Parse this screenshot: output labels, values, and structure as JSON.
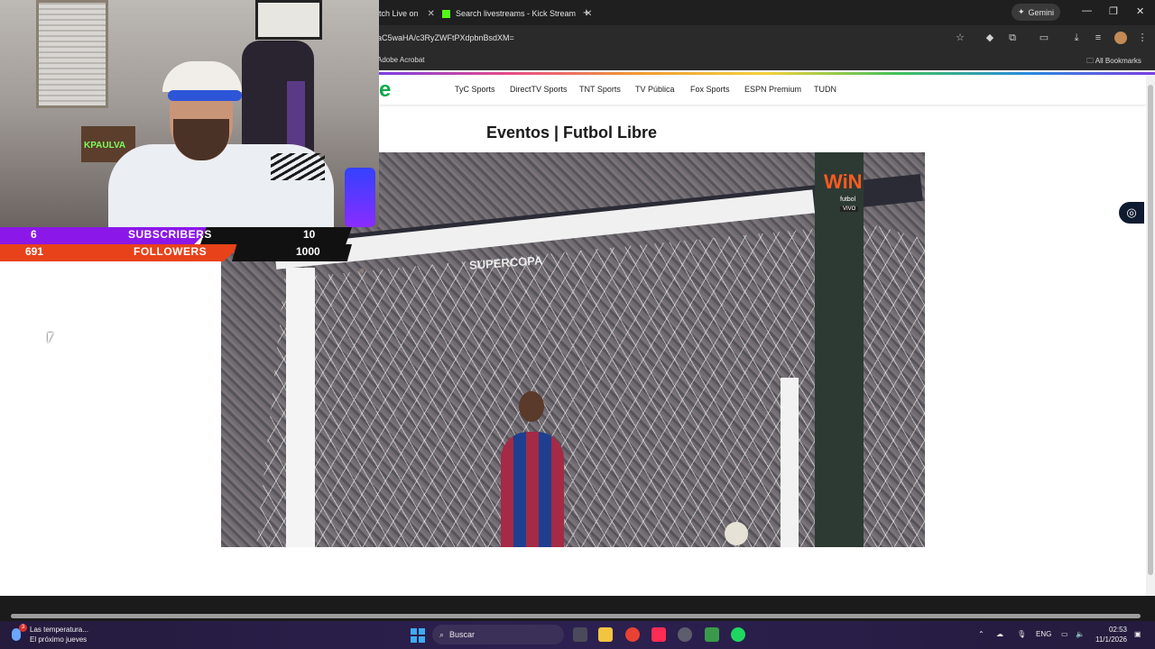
{
  "browser": {
    "tabs": [
      {
        "label": "tch Live on"
      },
      {
        "label": "Search livestreams - Kick Stream"
      }
    ],
    "new_tab_label": "+",
    "gemini_label": "Gemini",
    "url": "aC5waHA/c3RyZWFtPXdpbnBsdXM=",
    "bookmarks": {
      "left_item": "Adobe Acrobat",
      "right_item": "All Bookmarks"
    }
  },
  "site": {
    "logo": "e",
    "nav": [
      "TyC Sports",
      "DirectTV Sports",
      "TNT Sports",
      "TV Pública",
      "Fox Sports",
      "ESPN Premium",
      "TUDN"
    ],
    "page_title": "Eventos | Futbol Libre"
  },
  "video": {
    "board_text": "SUPERCOPA",
    "broadcaster": "WiN",
    "broadcaster_sub": "futbol",
    "live_tag": "VIVO"
  },
  "overlay": {
    "subscribers": {
      "current": "6",
      "label": "SUBSCRIBERS",
      "goal": "10",
      "progress": 0.6,
      "color": "#8b18e8"
    },
    "followers": {
      "current": "691",
      "label": "FOLLOWERS",
      "goal": "1000",
      "progress": 0.691,
      "color": "#e8421a"
    },
    "neon_sign": "KPAULVA"
  },
  "taskbar": {
    "weather_line1": "Las temperatura...",
    "weather_line2": "El próximo jueves",
    "weather_badge": "3",
    "search_placeholder": "Buscar",
    "language": "ENG",
    "time": "02:53",
    "date": "11/1/2026"
  },
  "colors": {
    "accent_green": "#0fa84a",
    "chrome_dark": "#1f1f1f",
    "taskbar": "#2c2050"
  }
}
